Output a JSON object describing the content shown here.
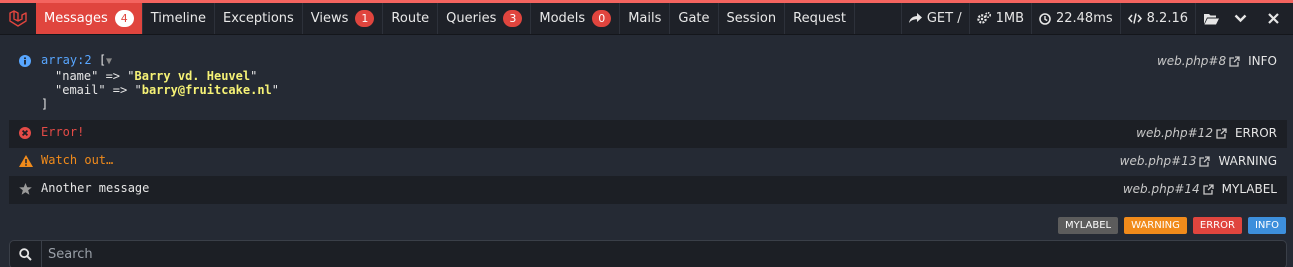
{
  "tabs": [
    {
      "label": "Messages",
      "badge": "4"
    },
    {
      "label": "Timeline"
    },
    {
      "label": "Exceptions"
    },
    {
      "label": "Views",
      "badge": "1"
    },
    {
      "label": "Route"
    },
    {
      "label": "Queries",
      "badge": "3"
    },
    {
      "label": "Models",
      "badge": "0"
    },
    {
      "label": "Mails"
    },
    {
      "label": "Gate"
    },
    {
      "label": "Session"
    },
    {
      "label": "Request"
    }
  ],
  "meta": {
    "request": "GET /",
    "memory": "1MB",
    "time": "22.48ms",
    "php": "8.2.16"
  },
  "messages": {
    "array": {
      "type": "array:2",
      "open": "[",
      "toggle": "▼",
      "close": "]",
      "items": [
        {
          "key": "\"name\"",
          "arrow": " => ",
          "q1": "\"",
          "value": "Barry vd. Heuvel",
          "q2": "\""
        },
        {
          "key": "\"email\"",
          "arrow": " => ",
          "q1": "\"",
          "value": "barry@fruitcake.nl",
          "q2": "\""
        }
      ],
      "file": "web.php#8",
      "level": "INFO"
    },
    "error": {
      "text": "Error!",
      "file": "web.php#12",
      "level": "ERROR"
    },
    "warning": {
      "text": "Watch out…",
      "file": "web.php#13",
      "level": "WARNING"
    },
    "other": {
      "text": "Another message",
      "file": "web.php#14",
      "level": "MYLABEL"
    }
  },
  "labels": [
    {
      "text": "MYLABEL",
      "color": "#5c5c5c"
    },
    {
      "text": "WARNING",
      "color": "#f18b1b"
    },
    {
      "text": "ERROR",
      "color": "#e0453e"
    },
    {
      "text": "INFO",
      "color": "#3d8fdc"
    }
  ],
  "search": {
    "placeholder": "Search"
  },
  "colors": {
    "accent": "#e0453e",
    "info": "#58a6ff",
    "warning": "#f18b1b",
    "error": "#e44b47"
  }
}
